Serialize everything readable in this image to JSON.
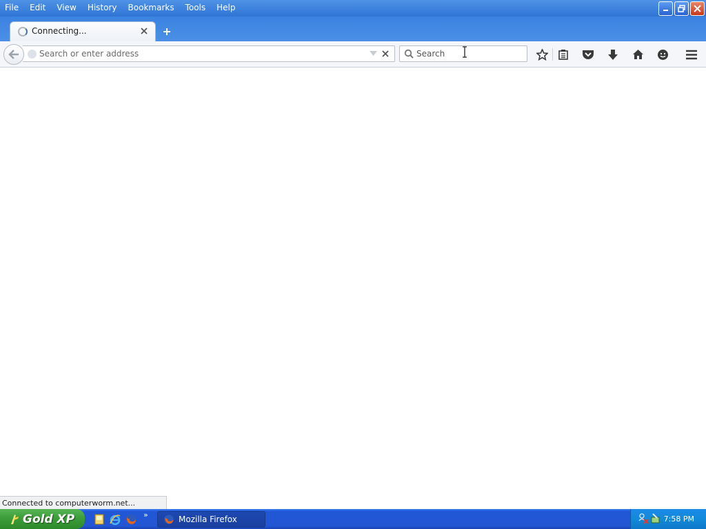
{
  "menu": [
    "File",
    "Edit",
    "View",
    "History",
    "Bookmarks",
    "Tools",
    "Help"
  ],
  "tab": {
    "title": "Connecting..."
  },
  "urlbar": {
    "placeholder": "Search or enter address",
    "value": ""
  },
  "searchbar": {
    "placeholder": "Search",
    "value": ""
  },
  "toolbar_icons": [
    "bookmark-star-icon",
    "reading-list-icon",
    "pocket-icon",
    "download-icon",
    "home-icon",
    "hello-icon",
    "menu-icon"
  ],
  "status": {
    "text": "Connected to computerworm.net..."
  },
  "taskbar": {
    "start_label": "Gold XP",
    "task_label": "Mozilla Firefox",
    "clock": "7:58 PM",
    "quicklaunch_more": "»"
  },
  "colors": {
    "title_blue": "#2f74d4",
    "taskbar_blue": "#2256d3",
    "start_green": "#3a9b38"
  }
}
